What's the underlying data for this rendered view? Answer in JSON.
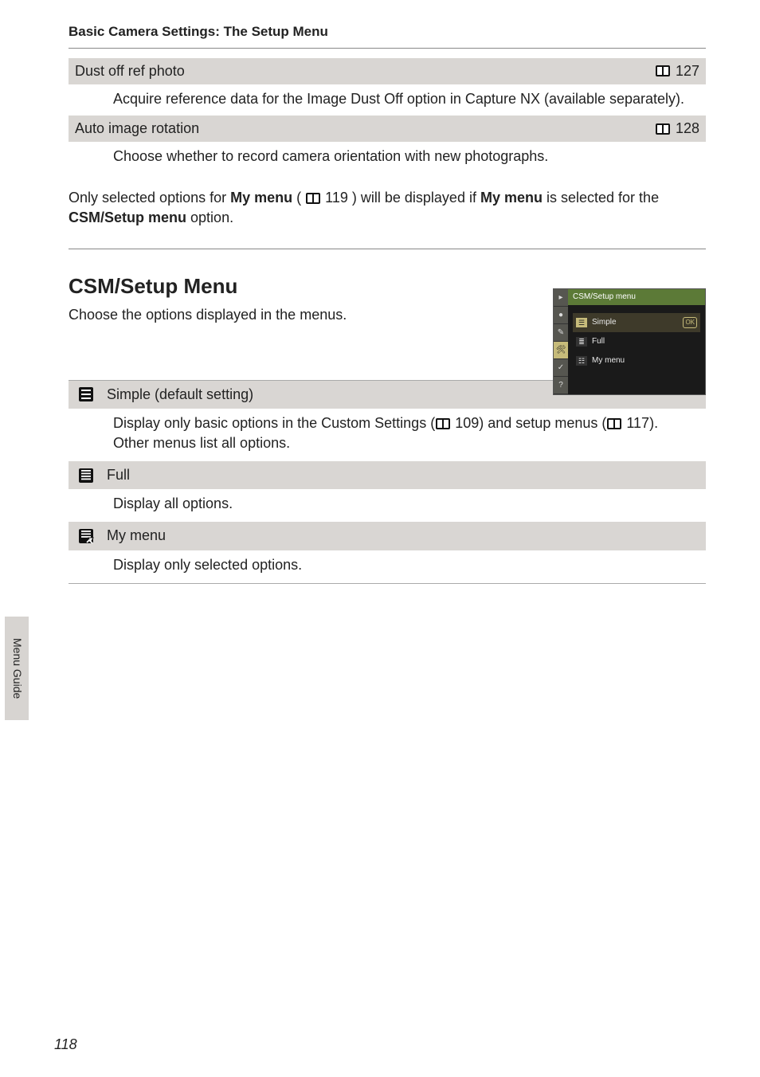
{
  "running_head": "Basic Camera Settings: The Setup Menu",
  "rows": [
    {
      "title": "Dust off ref photo",
      "page": "127",
      "desc": "Acquire reference data for the Image Dust Off option in Capture NX (available separately)."
    },
    {
      "title": "Auto image rotation",
      "page": "128",
      "desc": "Choose whether to record camera orientation with new photographs."
    }
  ],
  "mid_text": {
    "pre": "Only selected options for ",
    "b1": "My menu",
    "paren_open": " (",
    "pg1": "119",
    "paren_close": ") will be displayed if ",
    "b2": "My menu",
    "post": " is selected for the ",
    "b3": "CSM/Setup menu",
    "last": " option."
  },
  "subhead": "CSM/Setup Menu",
  "intro": "Choose the options displayed in the menus.",
  "lcd": {
    "title": "CSM/Setup menu",
    "items": [
      {
        "label": "Simple",
        "selected": true
      },
      {
        "label": "Full",
        "selected": false
      },
      {
        "label": "My menu",
        "selected": false
      }
    ],
    "ok": "OK",
    "tabs": [
      "▸",
      "●",
      "✎",
      "🛠",
      "✓",
      "?"
    ]
  },
  "options": [
    {
      "icon": "simple",
      "title": "Simple (default setting)",
      "desc_pre": "Display only basic options in the Custom Settings (",
      "pg_a": "109",
      "desc_mid": ") and setup menus (",
      "pg_b": "117",
      "desc_post": "). Other menus list all options."
    },
    {
      "icon": "full",
      "title": "Full",
      "desc_plain": "Display all options."
    },
    {
      "icon": "mymenu",
      "title": "My menu",
      "desc_plain": "Display only selected options."
    }
  ],
  "side_tab": "Menu Guide",
  "page_number": "118"
}
